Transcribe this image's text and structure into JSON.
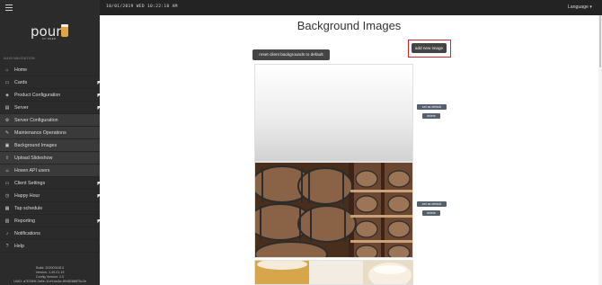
{
  "topbar": {
    "datetime": "10/01/2019 WED   10:22:10 AM",
    "language": "Language ▾"
  },
  "sidebar": {
    "logo": "pour",
    "logo_sub": "MY BEER",
    "section_label": "MAIN NAVIGATION",
    "items": [
      {
        "label": "Home",
        "icon": "home-icon"
      },
      {
        "label": "Cards",
        "icon": "card-icon"
      },
      {
        "label": "Product Configuration",
        "icon": "tag-icon"
      },
      {
        "label": "Server",
        "icon": "server-icon"
      },
      {
        "label": "Server Configuration",
        "icon": "gear-icon"
      },
      {
        "label": "Maintenance Operations",
        "icon": "wrench-icon"
      },
      {
        "label": "Background Images",
        "icon": "image-icon"
      },
      {
        "label": "Upload Slideshow",
        "icon": "upload-icon"
      },
      {
        "label": "Hoven API users",
        "icon": "user-icon"
      },
      {
        "label": "Client Settings",
        "icon": "desktop-icon"
      },
      {
        "label": "Happy Hour",
        "icon": "clock-icon"
      },
      {
        "label": "Tap schedule",
        "icon": "calendar-icon"
      },
      {
        "label": "Reporting",
        "icon": "chart-icon"
      },
      {
        "label": "Notifications",
        "icon": "bell-icon"
      },
      {
        "label": "Help",
        "icon": "help-icon"
      }
    ],
    "build": {
      "line1": "Build: 2020091813",
      "line2": "Version: 1.49.21.19",
      "line3": "Config Version: 2.0",
      "line4": "UUID: a7f2389f-2a5e-11e9-ba3e-8945288870c2e"
    }
  },
  "main": {
    "title": "Background Images",
    "add_button": "add new image",
    "reset_button": "reset client backgrounds to default",
    "images": [
      {
        "set_default": "set as default",
        "delete": "delete"
      },
      {
        "set_default": "set as default",
        "delete": "delete"
      },
      {}
    ]
  }
}
